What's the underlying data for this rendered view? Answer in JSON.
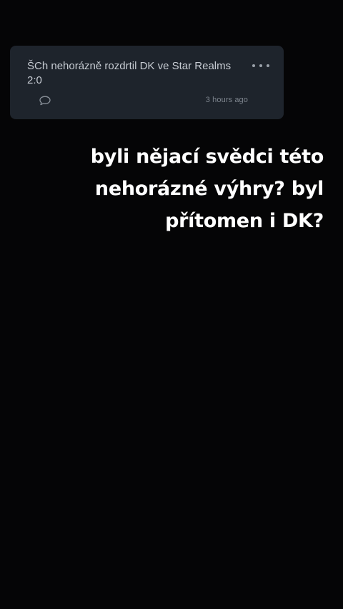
{
  "post": {
    "title": "ŠCh nehorázně rozdrtil DK ve Star Realms 2:0",
    "time_ago": "3 hours ago",
    "comment_icon": "comment-icon",
    "more_icon": "more-horizontal-icon"
  },
  "caption": {
    "lines": [
      "byli nějací svědci této",
      "nehorázné výhry? byl",
      "přítomen i DK?"
    ]
  },
  "colors": {
    "background": "#050506",
    "card": "#1e242c",
    "caption_text": "#ffffff"
  }
}
